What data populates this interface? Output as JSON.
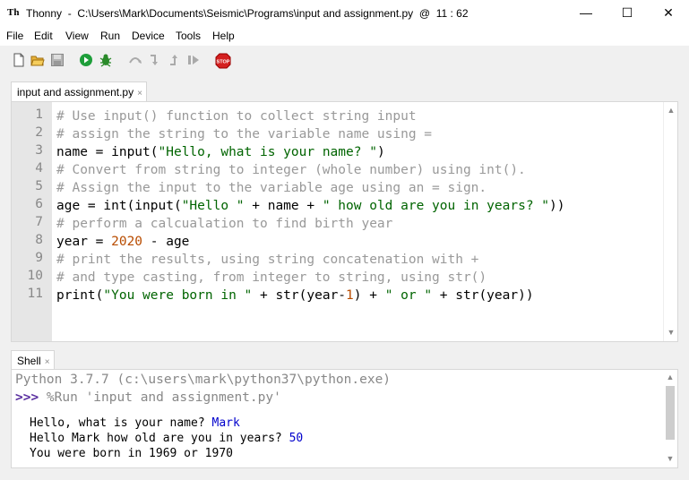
{
  "window": {
    "app_name": "Thonny",
    "path": "C:\\Users\\Mark\\Documents\\Seismic\\Programs\\input and assignment.py",
    "at": "@",
    "position": "11 : 62",
    "minimize": "—",
    "maximize": "☐",
    "close": "✕"
  },
  "menu": [
    "File",
    "Edit",
    "View",
    "Run",
    "Device",
    "Tools",
    "Help"
  ],
  "toolbar": {
    "stop_label": "STOP"
  },
  "editor": {
    "tab_label": "input and assignment.py",
    "tab_close": "×",
    "line_numbers": [
      "1",
      "2",
      "3",
      "4",
      "5",
      "6",
      "7",
      "8",
      "9",
      "10",
      "11"
    ],
    "lines": {
      "l1": "# Use input() function to collect string input",
      "l2": "# assign the string to the variable name using =",
      "l3a": "name = input(",
      "l3b": "\"Hello, what is your name? \"",
      "l3c": ")",
      "l4": "# Convert from string to integer (whole number) using int().",
      "l5": "# Assign the input to the variable age using an = sign.",
      "l6a": "age = int(input(",
      "l6b": "\"Hello \"",
      "l6c": " + name + ",
      "l6d": "\" how old are you in years? \"",
      "l6e": "))",
      "l7": "# perform a calcualation to find birth year",
      "l8a": "year = ",
      "l8b": "2020",
      "l8c": " - age",
      "l9": "# print the results, using string concatenation with +",
      "l10": "# and type casting, from integer to string, using str()",
      "l11a": "print(",
      "l11b": "\"You were born in \"",
      "l11c": " + str(year-",
      "l11d": "1",
      "l11e": ") + ",
      "l11f": "\" or \"",
      "l11g": " + str(year))"
    }
  },
  "shell": {
    "tab_label": "Shell",
    "tab_close": "×",
    "version_line": "Python 3.7.7 (c:\\users\\mark\\python37\\python.exe)",
    "prompt": ">>>",
    "run_command": " %Run 'input and assignment.py'",
    "out1_text": "Hello, what is your name? ",
    "out1_input": "Mark",
    "out2_text": "Hello Mark how old are you in years? ",
    "out2_input": "50",
    "out3_text": "You were born in 1969 or 1970"
  },
  "colors": {
    "comment": "#999999",
    "string": "#006400",
    "number": "#b84c00",
    "prompt": "#5a2fa0",
    "user_input": "#0000cc"
  }
}
